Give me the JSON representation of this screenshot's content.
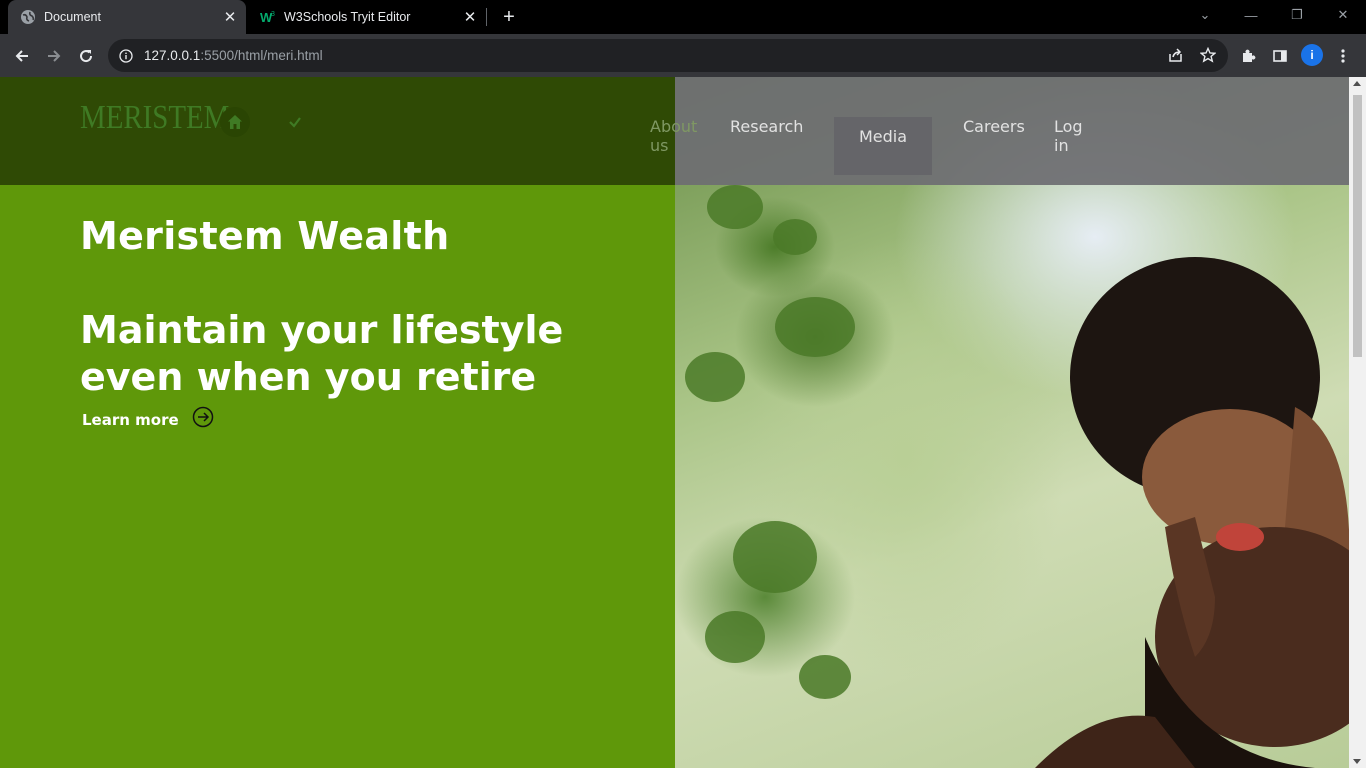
{
  "browser": {
    "tabs": [
      {
        "title": "Document",
        "active": true,
        "icon": "globe-icon"
      },
      {
        "title": "W3Schools Tryit Editor",
        "active": false,
        "icon": "w3schools-icon"
      }
    ],
    "address": {
      "host": "127.0.0.1",
      "rest": ":5500/html/meri.html"
    },
    "profile_initial": "i"
  },
  "site": {
    "logo": "MERISTEM",
    "nav": {
      "about": "About us",
      "research": "Research",
      "media": "Media",
      "careers": "Careers",
      "login": "Log in"
    },
    "hero": {
      "title": "Meristem Wealth",
      "subtitle": "Maintain your lifestyle even when you retire",
      "cta": "Learn more"
    }
  },
  "colors": {
    "hero_green": "#5f980a",
    "nav_dark_green": "#2f4a05",
    "nav_grey": "#6e6e72"
  }
}
